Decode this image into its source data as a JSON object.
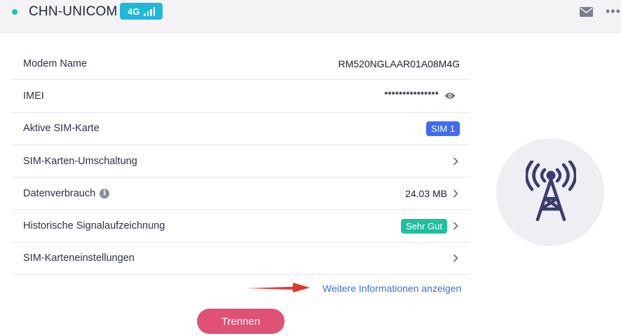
{
  "header": {
    "carrier": "CHN-UNICOM",
    "network_type": "4G",
    "signal_bars": 4,
    "status_color": "#22c2a6",
    "more_glyph": "•••"
  },
  "rows": [
    {
      "label": "Modem Name",
      "value": "RM520NGLAAR01A08M4G"
    },
    {
      "label": "IMEI",
      "value": "***************"
    },
    {
      "label": "Aktive SIM-Karte",
      "badge": "SIM 1"
    },
    {
      "label": "SIM-Karten-Umschaltung"
    },
    {
      "label": "Datenverbrauch",
      "info_glyph": "i",
      "value": "24.03 MB"
    },
    {
      "label": "Historische Signalaufzeichnung",
      "badge": "Sehr Gut"
    },
    {
      "label": "SIM-Karteneinstellungen"
    }
  ],
  "more_info_link": "Weitere Informationen anzeigen",
  "disconnect_button": "Trennen",
  "colors": {
    "accent_blue": "#3f6cf0",
    "good_green": "#1fbfa1",
    "button_pink": "#e05275",
    "link_blue": "#3e6ee6",
    "arrow_red": "#e8362a",
    "tower_navy": "#3a3d6e"
  }
}
